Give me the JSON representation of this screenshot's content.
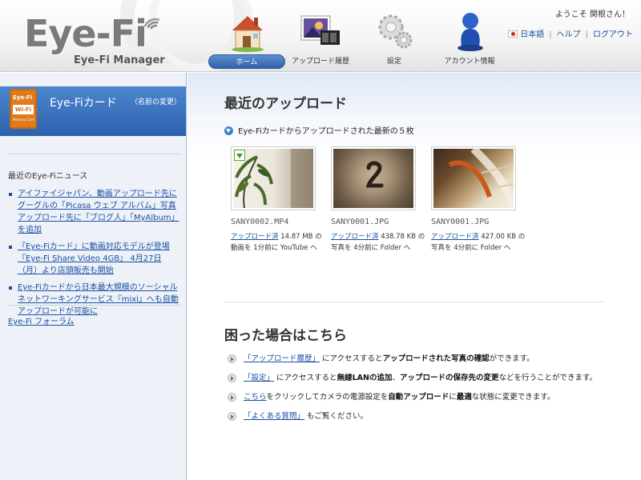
{
  "header": {
    "logo_text": "Eye-Fi",
    "logo_sub": "Eye-Fi Manager",
    "welcome": "ようこそ 関根さん！",
    "links": [
      "日本語",
      "ヘルプ",
      "ログアウト"
    ]
  },
  "nav": {
    "items": [
      {
        "label": "ホーム",
        "icon": "house-icon",
        "active": true
      },
      {
        "label": "アップロード履歴",
        "icon": "photo-film-icon",
        "active": false
      },
      {
        "label": "設定",
        "icon": "gears-icon",
        "active": false
      },
      {
        "label": "アカウント情報",
        "icon": "user-icon",
        "active": false
      }
    ]
  },
  "sidebar": {
    "card_img": {
      "top": "Eye-Fi",
      "mid": "Wi-Fi",
      "bottom": "Memory Card"
    },
    "card_name": "Eye-Fiカード",
    "rename": "（名前の変更）",
    "news_title": "最近のEye-Fiニュース",
    "news": [
      "アイファイジャパン、動画アップロード先にグーグルの「Picasa ウェブ アルバム」写真アップロード先に「ブログ人」「MyAlbum」を追加",
      "『Eye-Fiカード』に動画対応モデルが登場『Eye-Fi Share Video 4GB』 4月27日（月）より店頭販売も開始",
      "Eye-Fiカードから日本最大規模のソーシャルネットワーキングサービス『mixi』へも自動アップロードが可能に"
    ],
    "forum": "Eye-Fi フォーラム"
  },
  "main": {
    "recent_title": "最近のアップロード",
    "recent_sub": "Eye-Fiカードからアップロードされた最新の５枚",
    "uploads": [
      {
        "name": "SANY0002.MP4",
        "status": "アップロード済",
        "desc": " 14.87 MB の動画を 1分前に YouTube へ"
      },
      {
        "name": "SANY0001.JPG",
        "status": "アップロード済",
        "desc": " 438.78 KB の写真を 4分前に Folder へ"
      },
      {
        "name": "SANY0001.JPG",
        "status": "アップロード済",
        "desc": " 427.00 KB の写真を 4分前に Folder へ"
      }
    ],
    "help_title": "困った場合はこちら",
    "help": [
      {
        "link": "「アップロード履歴」",
        "pre": "",
        "text1": " にアクセスすると",
        "bold1": "アップロードされた写真の確認",
        "text2": "ができます。",
        "bold2": "",
        "text3": ""
      },
      {
        "link": "「設定」",
        "pre": "",
        "text1": " にアクセスすると",
        "bold1": "無線LANの追加",
        "text2": "、",
        "bold2": "アップロードの保存先の変更",
        "text3": "などを行うことができます。"
      },
      {
        "link": "こちら",
        "pre": "",
        "text1": "をクリックしてカメラの電源設定を",
        "bold1": "自動アップロード",
        "text2": "に",
        "bold2": "最適",
        "text3": "な状態に変更できます。"
      },
      {
        "link": "「よくある質問」",
        "pre": "",
        "text1": " もご覧ください。",
        "bold1": "",
        "text2": "",
        "bold2": "",
        "text3": ""
      }
    ]
  }
}
